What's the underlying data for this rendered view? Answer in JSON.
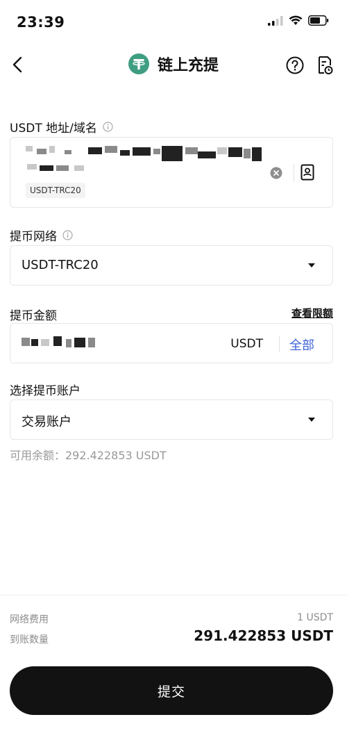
{
  "status_bar": {
    "time": "23:39"
  },
  "header": {
    "title": "链上充提"
  },
  "address": {
    "label": "USDT 地址/域名",
    "network_tag": "USDT-TRC20"
  },
  "network": {
    "label": "提币网络",
    "value": "USDT-TRC20"
  },
  "amount": {
    "label": "提币金额",
    "limit_link": "查看限额",
    "unit": "USDT",
    "all_button": "全部"
  },
  "account": {
    "label": "选择提币账户",
    "value": "交易账户"
  },
  "available": "可用余额：292.422853 USDT",
  "footer": {
    "fee_label": "网络费用",
    "fee_value": "1 USDT",
    "receive_label": "到账数量",
    "receive_value": "291.422853 USDT",
    "submit_label": "提交"
  },
  "colors": {
    "accent": "#3d63d6",
    "tether": "#3f9e82",
    "button": "#121212"
  }
}
